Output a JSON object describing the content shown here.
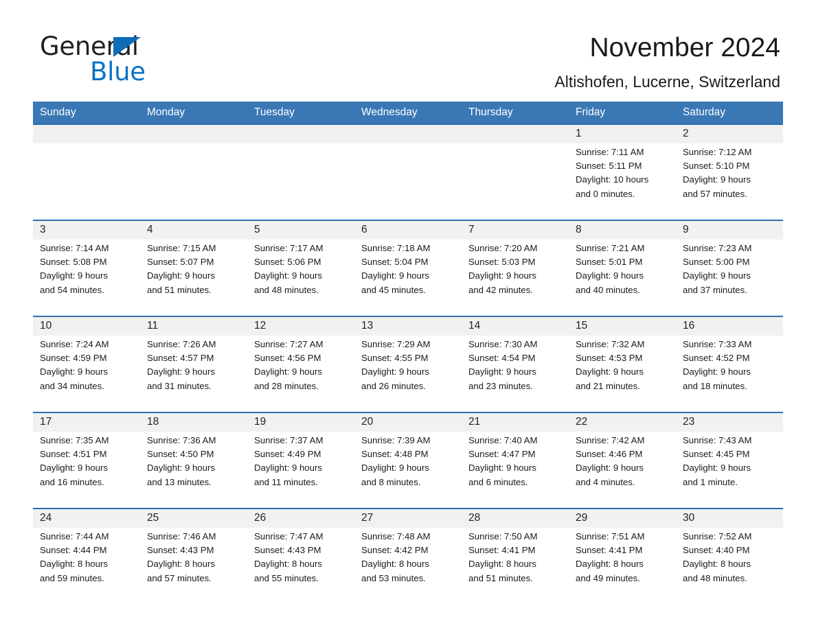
{
  "brand": {
    "name_part1": "General",
    "name_part2": "Blue",
    "logo_icon": "triangle-icon"
  },
  "header": {
    "month_title": "November 2024",
    "location": "Altishofen, Lucerne, Switzerland"
  },
  "colors": {
    "header_blue": "#3a77b5",
    "separator_blue": "#2f6fad",
    "date_band": "#f1f1f1",
    "brand_blue": "#0b72c4"
  },
  "calendar": {
    "day_headers": [
      "Sunday",
      "Monday",
      "Tuesday",
      "Wednesday",
      "Thursday",
      "Friday",
      "Saturday"
    ],
    "weeks": [
      [
        {
          "day": "",
          "sunrise": "",
          "sunset": "",
          "daylight1": "",
          "daylight2": ""
        },
        {
          "day": "",
          "sunrise": "",
          "sunset": "",
          "daylight1": "",
          "daylight2": ""
        },
        {
          "day": "",
          "sunrise": "",
          "sunset": "",
          "daylight1": "",
          "daylight2": ""
        },
        {
          "day": "",
          "sunrise": "",
          "sunset": "",
          "daylight1": "",
          "daylight2": ""
        },
        {
          "day": "",
          "sunrise": "",
          "sunset": "",
          "daylight1": "",
          "daylight2": ""
        },
        {
          "day": "1",
          "sunrise": "Sunrise: 7:11 AM",
          "sunset": "Sunset: 5:11 PM",
          "daylight1": "Daylight: 10 hours",
          "daylight2": "and 0 minutes."
        },
        {
          "day": "2",
          "sunrise": "Sunrise: 7:12 AM",
          "sunset": "Sunset: 5:10 PM",
          "daylight1": "Daylight: 9 hours",
          "daylight2": "and 57 minutes."
        }
      ],
      [
        {
          "day": "3",
          "sunrise": "Sunrise: 7:14 AM",
          "sunset": "Sunset: 5:08 PM",
          "daylight1": "Daylight: 9 hours",
          "daylight2": "and 54 minutes."
        },
        {
          "day": "4",
          "sunrise": "Sunrise: 7:15 AM",
          "sunset": "Sunset: 5:07 PM",
          "daylight1": "Daylight: 9 hours",
          "daylight2": "and 51 minutes."
        },
        {
          "day": "5",
          "sunrise": "Sunrise: 7:17 AM",
          "sunset": "Sunset: 5:06 PM",
          "daylight1": "Daylight: 9 hours",
          "daylight2": "and 48 minutes."
        },
        {
          "day": "6",
          "sunrise": "Sunrise: 7:18 AM",
          "sunset": "Sunset: 5:04 PM",
          "daylight1": "Daylight: 9 hours",
          "daylight2": "and 45 minutes."
        },
        {
          "day": "7",
          "sunrise": "Sunrise: 7:20 AM",
          "sunset": "Sunset: 5:03 PM",
          "daylight1": "Daylight: 9 hours",
          "daylight2": "and 42 minutes."
        },
        {
          "day": "8",
          "sunrise": "Sunrise: 7:21 AM",
          "sunset": "Sunset: 5:01 PM",
          "daylight1": "Daylight: 9 hours",
          "daylight2": "and 40 minutes."
        },
        {
          "day": "9",
          "sunrise": "Sunrise: 7:23 AM",
          "sunset": "Sunset: 5:00 PM",
          "daylight1": "Daylight: 9 hours",
          "daylight2": "and 37 minutes."
        }
      ],
      [
        {
          "day": "10",
          "sunrise": "Sunrise: 7:24 AM",
          "sunset": "Sunset: 4:59 PM",
          "daylight1": "Daylight: 9 hours",
          "daylight2": "and 34 minutes."
        },
        {
          "day": "11",
          "sunrise": "Sunrise: 7:26 AM",
          "sunset": "Sunset: 4:57 PM",
          "daylight1": "Daylight: 9 hours",
          "daylight2": "and 31 minutes."
        },
        {
          "day": "12",
          "sunrise": "Sunrise: 7:27 AM",
          "sunset": "Sunset: 4:56 PM",
          "daylight1": "Daylight: 9 hours",
          "daylight2": "and 28 minutes."
        },
        {
          "day": "13",
          "sunrise": "Sunrise: 7:29 AM",
          "sunset": "Sunset: 4:55 PM",
          "daylight1": "Daylight: 9 hours",
          "daylight2": "and 26 minutes."
        },
        {
          "day": "14",
          "sunrise": "Sunrise: 7:30 AM",
          "sunset": "Sunset: 4:54 PM",
          "daylight1": "Daylight: 9 hours",
          "daylight2": "and 23 minutes."
        },
        {
          "day": "15",
          "sunrise": "Sunrise: 7:32 AM",
          "sunset": "Sunset: 4:53 PM",
          "daylight1": "Daylight: 9 hours",
          "daylight2": "and 21 minutes."
        },
        {
          "day": "16",
          "sunrise": "Sunrise: 7:33 AM",
          "sunset": "Sunset: 4:52 PM",
          "daylight1": "Daylight: 9 hours",
          "daylight2": "and 18 minutes."
        }
      ],
      [
        {
          "day": "17",
          "sunrise": "Sunrise: 7:35 AM",
          "sunset": "Sunset: 4:51 PM",
          "daylight1": "Daylight: 9 hours",
          "daylight2": "and 16 minutes."
        },
        {
          "day": "18",
          "sunrise": "Sunrise: 7:36 AM",
          "sunset": "Sunset: 4:50 PM",
          "daylight1": "Daylight: 9 hours",
          "daylight2": "and 13 minutes."
        },
        {
          "day": "19",
          "sunrise": "Sunrise: 7:37 AM",
          "sunset": "Sunset: 4:49 PM",
          "daylight1": "Daylight: 9 hours",
          "daylight2": "and 11 minutes."
        },
        {
          "day": "20",
          "sunrise": "Sunrise: 7:39 AM",
          "sunset": "Sunset: 4:48 PM",
          "daylight1": "Daylight: 9 hours",
          "daylight2": "and 8 minutes."
        },
        {
          "day": "21",
          "sunrise": "Sunrise: 7:40 AM",
          "sunset": "Sunset: 4:47 PM",
          "daylight1": "Daylight: 9 hours",
          "daylight2": "and 6 minutes."
        },
        {
          "day": "22",
          "sunrise": "Sunrise: 7:42 AM",
          "sunset": "Sunset: 4:46 PM",
          "daylight1": "Daylight: 9 hours",
          "daylight2": "and 4 minutes."
        },
        {
          "day": "23",
          "sunrise": "Sunrise: 7:43 AM",
          "sunset": "Sunset: 4:45 PM",
          "daylight1": "Daylight: 9 hours",
          "daylight2": "and 1 minute."
        }
      ],
      [
        {
          "day": "24",
          "sunrise": "Sunrise: 7:44 AM",
          "sunset": "Sunset: 4:44 PM",
          "daylight1": "Daylight: 8 hours",
          "daylight2": "and 59 minutes."
        },
        {
          "day": "25",
          "sunrise": "Sunrise: 7:46 AM",
          "sunset": "Sunset: 4:43 PM",
          "daylight1": "Daylight: 8 hours",
          "daylight2": "and 57 minutes."
        },
        {
          "day": "26",
          "sunrise": "Sunrise: 7:47 AM",
          "sunset": "Sunset: 4:43 PM",
          "daylight1": "Daylight: 8 hours",
          "daylight2": "and 55 minutes."
        },
        {
          "day": "27",
          "sunrise": "Sunrise: 7:48 AM",
          "sunset": "Sunset: 4:42 PM",
          "daylight1": "Daylight: 8 hours",
          "daylight2": "and 53 minutes."
        },
        {
          "day": "28",
          "sunrise": "Sunrise: 7:50 AM",
          "sunset": "Sunset: 4:41 PM",
          "daylight1": "Daylight: 8 hours",
          "daylight2": "and 51 minutes."
        },
        {
          "day": "29",
          "sunrise": "Sunrise: 7:51 AM",
          "sunset": "Sunset: 4:41 PM",
          "daylight1": "Daylight: 8 hours",
          "daylight2": "and 49 minutes."
        },
        {
          "day": "30",
          "sunrise": "Sunrise: 7:52 AM",
          "sunset": "Sunset: 4:40 PM",
          "daylight1": "Daylight: 8 hours",
          "daylight2": "and 48 minutes."
        }
      ]
    ]
  }
}
